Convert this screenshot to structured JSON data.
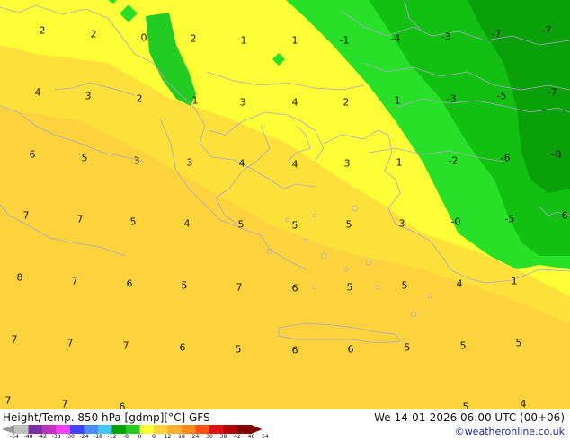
{
  "map": {
    "title": "Height/Temp. 850 hPa [gdmp][°C] GFS",
    "timestamp": "We 14-01-2026 06:00 UTC (00+06)",
    "credit": "©weatheronline.co.uk",
    "colors": {
      "warm_orange": "#fcd33c",
      "yellow_orange": "#fde03a",
      "yellow": "#fefe36",
      "light_green": "#28e028",
      "green": "#11c011",
      "dark_green": "#0aa00a"
    },
    "colorbar": {
      "ticks": [
        "-54",
        "-48",
        "-42",
        "-38",
        "-30",
        "-24",
        "-18",
        "-12",
        "-8",
        "0",
        "8",
        "12",
        "18",
        "24",
        "30",
        "38",
        "42",
        "48",
        "54"
      ],
      "colors": [
        "#9a9a9a",
        "#c0c0c0",
        "#7a2ea8",
        "#c030c0",
        "#ff40ff",
        "#4040ff",
        "#4a8cff",
        "#40c8ff",
        "#00a000",
        "#22cc22",
        "#fefe36",
        "#ffd23c",
        "#ffb030",
        "#ff8a20",
        "#ff5010",
        "#e01010",
        "#b00000",
        "#800000"
      ]
    },
    "temperature_labels": [
      {
        "t": "2",
        "c": 47,
        "r": 34
      },
      {
        "t": "2",
        "c": 104,
        "r": 38
      },
      {
        "t": "0",
        "c": 160,
        "r": 42
      },
      {
        "t": "2",
        "c": 215,
        "r": 43
      },
      {
        "t": "1",
        "c": 271,
        "r": 45
      },
      {
        "t": "1",
        "c": 328,
        "r": 45
      },
      {
        "t": "-1",
        "c": 383,
        "r": 45
      },
      {
        "t": "-4",
        "c": 440,
        "r": 43
      },
      {
        "t": "-3",
        "c": 496,
        "r": 41
      },
      {
        "t": "-7",
        "c": 552,
        "r": 38
      },
      {
        "t": "-7",
        "c": 608,
        "r": 34
      },
      {
        "t": "4",
        "c": 42,
        "r": 103
      },
      {
        "t": "3",
        "c": 98,
        "r": 107
      },
      {
        "t": "2",
        "c": 155,
        "r": 110
      },
      {
        "t": "1",
        "c": 217,
        "r": 112
      },
      {
        "t": "3",
        "c": 270,
        "r": 114
      },
      {
        "t": "4",
        "c": 328,
        "r": 114
      },
      {
        "t": "2",
        "c": 385,
        "r": 114
      },
      {
        "t": "-1",
        "c": 440,
        "r": 112
      },
      {
        "t": "-3",
        "c": 502,
        "r": 110
      },
      {
        "t": "-5",
        "c": 558,
        "r": 107
      },
      {
        "t": "-7",
        "c": 614,
        "r": 103
      },
      {
        "t": "6",
        "c": 36,
        "r": 172
      },
      {
        "t": "5",
        "c": 94,
        "r": 176
      },
      {
        "t": "3",
        "c": 152,
        "r": 179
      },
      {
        "t": "3",
        "c": 211,
        "r": 181
      },
      {
        "t": "4",
        "c": 269,
        "r": 182
      },
      {
        "t": "4",
        "c": 328,
        "r": 183
      },
      {
        "t": "3",
        "c": 386,
        "r": 182
      },
      {
        "t": "1",
        "c": 444,
        "r": 181
      },
      {
        "t": "-2",
        "c": 504,
        "r": 179
      },
      {
        "t": "-6",
        "c": 562,
        "r": 176
      },
      {
        "t": "-8",
        "c": 619,
        "r": 172
      },
      {
        "t": "7",
        "c": 29,
        "r": 240
      },
      {
        "t": "7",
        "c": 89,
        "r": 244
      },
      {
        "t": "5",
        "c": 148,
        "r": 247
      },
      {
        "t": "4",
        "c": 208,
        "r": 249
      },
      {
        "t": "5",
        "c": 268,
        "r": 250
      },
      {
        "t": "5",
        "c": 328,
        "r": 251
      },
      {
        "t": "5",
        "c": 388,
        "r": 250
      },
      {
        "t": "3",
        "c": 447,
        "r": 249
      },
      {
        "t": "-0",
        "c": 507,
        "r": 247
      },
      {
        "t": "-5",
        "c": 567,
        "r": 244
      },
      {
        "t": "-6",
        "c": 626,
        "r": 240
      },
      {
        "t": "8",
        "c": 22,
        "r": 309
      },
      {
        "t": "7",
        "c": 83,
        "r": 313
      },
      {
        "t": "6",
        "c": 144,
        "r": 316
      },
      {
        "t": "5",
        "c": 205,
        "r": 318
      },
      {
        "t": "7",
        "c": 266,
        "r": 320
      },
      {
        "t": "6",
        "c": 328,
        "r": 321
      },
      {
        "t": "5",
        "c": 389,
        "r": 320
      },
      {
        "t": "5",
        "c": 450,
        "r": 318
      },
      {
        "t": "4",
        "c": 511,
        "r": 316
      },
      {
        "t": "1",
        "c": 572,
        "r": 313
      },
      {
        "t": "7",
        "c": 16,
        "r": 378
      },
      {
        "t": "7",
        "c": 78,
        "r": 382
      },
      {
        "t": "7",
        "c": 140,
        "r": 385
      },
      {
        "t": "6",
        "c": 203,
        "r": 387
      },
      {
        "t": "5",
        "c": 265,
        "r": 389
      },
      {
        "t": "6",
        "c": 328,
        "r": 390
      },
      {
        "t": "6",
        "c": 390,
        "r": 389
      },
      {
        "t": "5",
        "c": 453,
        "r": 387
      },
      {
        "t": "5",
        "c": 515,
        "r": 385
      },
      {
        "t": "5",
        "c": 577,
        "r": 382
      },
      {
        "t": "7",
        "c": 9,
        "r": 446
      },
      {
        "t": "7",
        "c": 72,
        "r": 450
      },
      {
        "t": "6",
        "c": 136,
        "r": 453
      },
      {
        "t": "5",
        "c": 518,
        "r": 453
      },
      {
        "t": "4",
        "c": 582,
        "r": 450
      }
    ]
  }
}
